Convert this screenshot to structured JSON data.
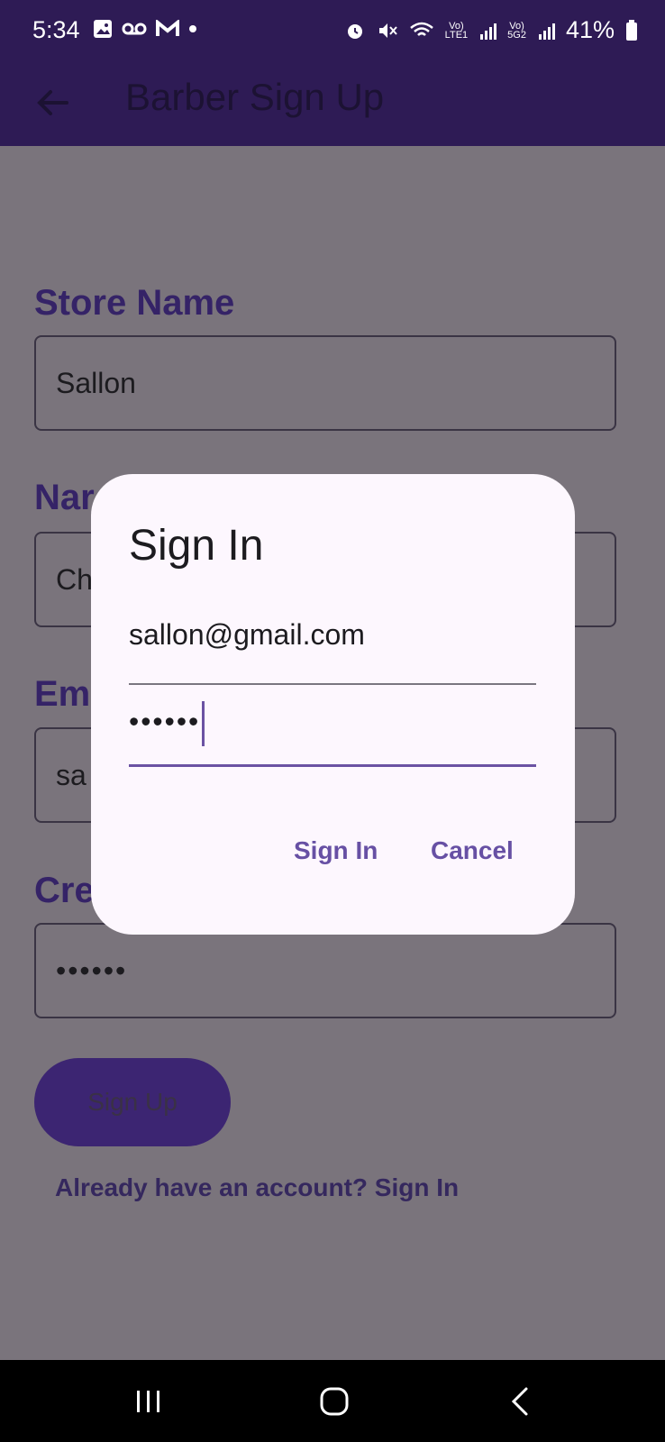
{
  "status": {
    "time": "5:34",
    "battery": "41%",
    "net1": "Vo)\nLTE1",
    "net2": "Vo)\n5G2"
  },
  "appbar": {
    "title": "Barber Sign Up"
  },
  "form": {
    "store_label": "Store Name",
    "store_value": "Sallon",
    "name_label": "Nar",
    "name_value": "Ch",
    "email_label": "Em",
    "email_value": "sa",
    "pass_label": "Cre",
    "pass_value": "••••••",
    "signup_label": "Sign Up",
    "signin_link": "Already have an account? Sign In"
  },
  "dialog": {
    "title": "Sign In",
    "email_value": "sallon@gmail.com",
    "password_value": "••••••",
    "signin_button": "Sign In",
    "cancel_button": "Cancel"
  },
  "colors": {
    "appbar": "#2e1b55",
    "accent": "#6750a4",
    "scrim": "#7a747c"
  }
}
